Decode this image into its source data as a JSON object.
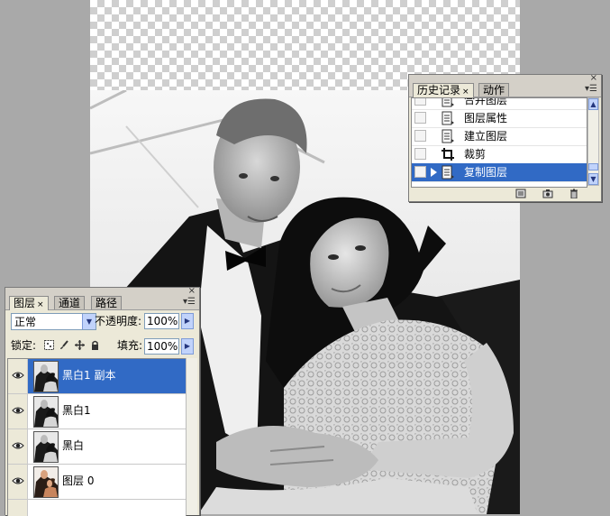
{
  "canvas": {
    "content": "black and white photo of a couple"
  },
  "history_panel": {
    "tabs": [
      {
        "label": "历史记录",
        "close": "×"
      },
      {
        "label": "动作"
      }
    ],
    "close_glyph": "×",
    "menu_glyph": "▾☰",
    "items": [
      {
        "label": "合并图层",
        "icon": "document-icon",
        "selected": false
      },
      {
        "label": "图层属性",
        "icon": "document-icon",
        "selected": false
      },
      {
        "label": "建立图层",
        "icon": "document-icon",
        "selected": false
      },
      {
        "label": "裁剪",
        "icon": "crop-icon",
        "selected": false
      },
      {
        "label": "复制图层",
        "icon": "document-icon",
        "selected": true
      }
    ],
    "bottom_icons": [
      "new-document-from-state-icon",
      "snapshot-camera-icon",
      "trash-icon"
    ],
    "selection_color": "#316ac5"
  },
  "layers_panel": {
    "tabs": [
      {
        "label": "图层",
        "close": "×"
      },
      {
        "label": "通道"
      },
      {
        "label": "路径"
      }
    ],
    "close_glyph": "×",
    "menu_glyph": "▾☰",
    "blend_mode": "正常",
    "opacity_label": "不透明度:",
    "opacity_value": "100%",
    "lock_label": "锁定:",
    "lock_icons": [
      "lock-transparent-icon",
      "lock-brush-icon",
      "lock-move-icon",
      "lock-all-icon"
    ],
    "fill_label": "填充:",
    "fill_value": "100%",
    "arrow_glyph": "▶",
    "dropdown_glyph": "▼",
    "layers": [
      {
        "name": "黑白1 副本",
        "visible": true,
        "selected": true,
        "thumb": "bw-photo"
      },
      {
        "name": "黑白1",
        "visible": true,
        "selected": false,
        "thumb": "bw-photo"
      },
      {
        "name": "黑白",
        "visible": true,
        "selected": false,
        "thumb": "bw-photo"
      },
      {
        "name": "图层 0",
        "visible": true,
        "selected": false,
        "thumb": "color-photo"
      }
    ]
  }
}
